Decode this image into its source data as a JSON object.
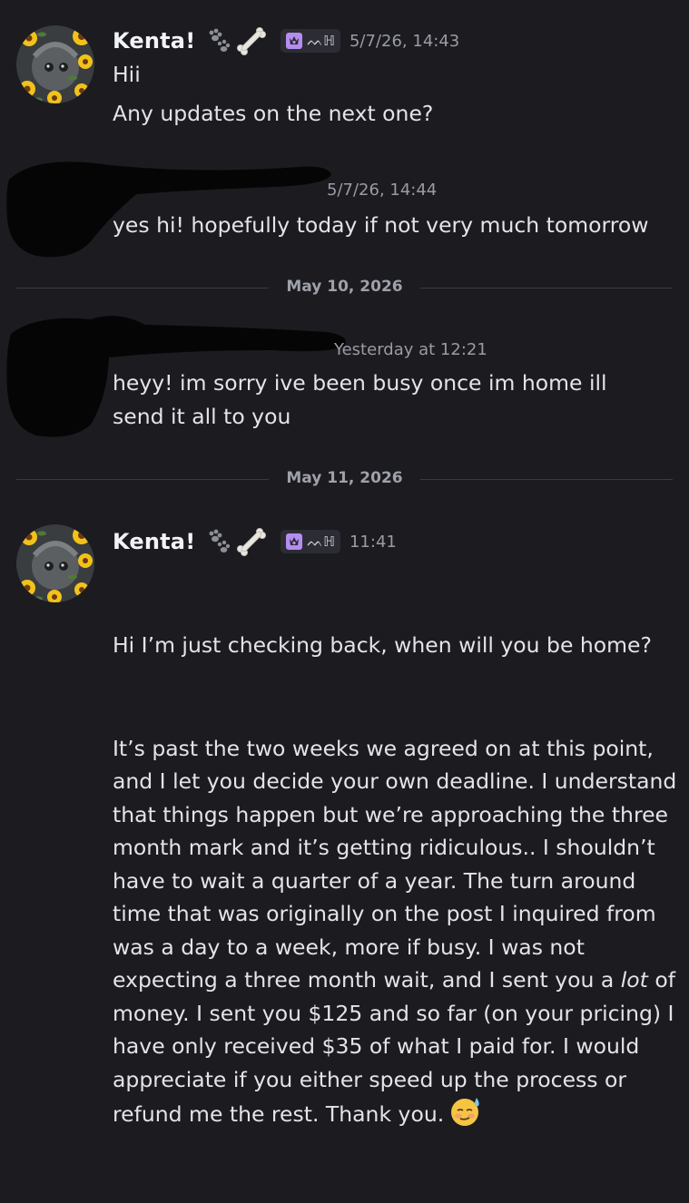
{
  "messages": [
    {
      "author": "Kenta!",
      "role_tag": "ᨓℍ",
      "timestamp": "5/7/26, 14:43",
      "lines": [
        "Hii",
        "Any updates on the next one?"
      ]
    },
    {
      "author": "",
      "timestamp": "5/7/26, 14:44",
      "lines": [
        "yes hi! hopefully today if not very much tomorrow"
      ]
    },
    {
      "author": "",
      "timestamp": "Yesterday at 12:21",
      "lines": [
        "heyy! im sorry ive been busy once im home ill send it all to you"
      ]
    },
    {
      "author": "Kenta!",
      "role_tag": "ᨓℍ",
      "timestamp": "11:41",
      "lines": [
        "Hi I’m just checking back, when will you be home?",
        "It’s past the two weeks we agreed on at this point, and I let you decide your own deadline. I understand that things happen but we’re approaching the three month mark and it’s getting ridiculous.. I shouldn’t have to wait a quarter of a year. The turn around time that was originally on the post I inquired from was a day to a week, more if busy. I was not expecting a three month wait, and I sent you a",
        "lot",
        "of money. I sent you $125 and so far (on your pricing) I have only received $35 of what I paid for. I would appreciate if you either speed up the process or refund me the rest. Thank you."
      ]
    }
  ],
  "dividers": [
    "May 10, 2026",
    "May 11, 2026"
  ],
  "icons": {
    "paw": "paw-prints-icon",
    "bone": "bone-icon",
    "role": "crown-badge-icon",
    "emoji": "sweat-smile-emoji"
  },
  "colors": {
    "background": "#1b1b20",
    "username": "#f2f3f5",
    "text": "#e3e4e8",
    "muted": "#9a9ca4",
    "role_badge": "#b58cf0",
    "divider": "#3a3b42"
  }
}
